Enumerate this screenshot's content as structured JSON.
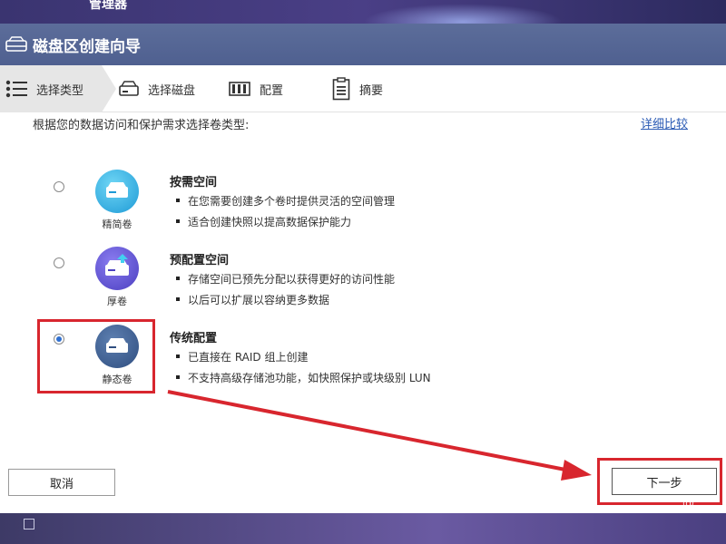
{
  "background": {
    "app_title": "管理器"
  },
  "dialog": {
    "title": "磁盘区创建向导"
  },
  "steps": [
    {
      "label": "选择类型",
      "icon": "list-icon"
    },
    {
      "label": "选择磁盘",
      "icon": "disk-icon"
    },
    {
      "label": "配置",
      "icon": "config-icon"
    },
    {
      "label": "摘要",
      "icon": "clipboard-icon"
    }
  ],
  "main": {
    "prompt": "根据您的数据访问和保护需求选择卷类型:",
    "compare_link": "详细比较",
    "options": [
      {
        "icon_label": "精简卷",
        "title": "按需空间",
        "selected": false,
        "bullets": [
          "在您需要创建多个卷时提供灵活的空间管理",
          "适合创建快照以提高数据保护能力"
        ]
      },
      {
        "icon_label": "厚卷",
        "title": "预配置空间",
        "selected": false,
        "bullets": [
          "存储空间已预先分配以获得更好的访问性能",
          "以后可以扩展以容纳更多数据"
        ]
      },
      {
        "icon_label": "静态卷",
        "title": "传统配置",
        "selected": true,
        "bullets": [
          "已直接在 RAID 组上创建",
          "不支持高级存储池功能，如快照保护或块级别 LUN"
        ]
      }
    ]
  },
  "footer": {
    "cancel_label": "取消",
    "next_label": "下一步"
  },
  "watermark": "@",
  "colors": {
    "header": "#5a6a96",
    "highlight": "#d8262e",
    "link": "#2b5bb5",
    "radio_selected": "#2f6fd0"
  }
}
